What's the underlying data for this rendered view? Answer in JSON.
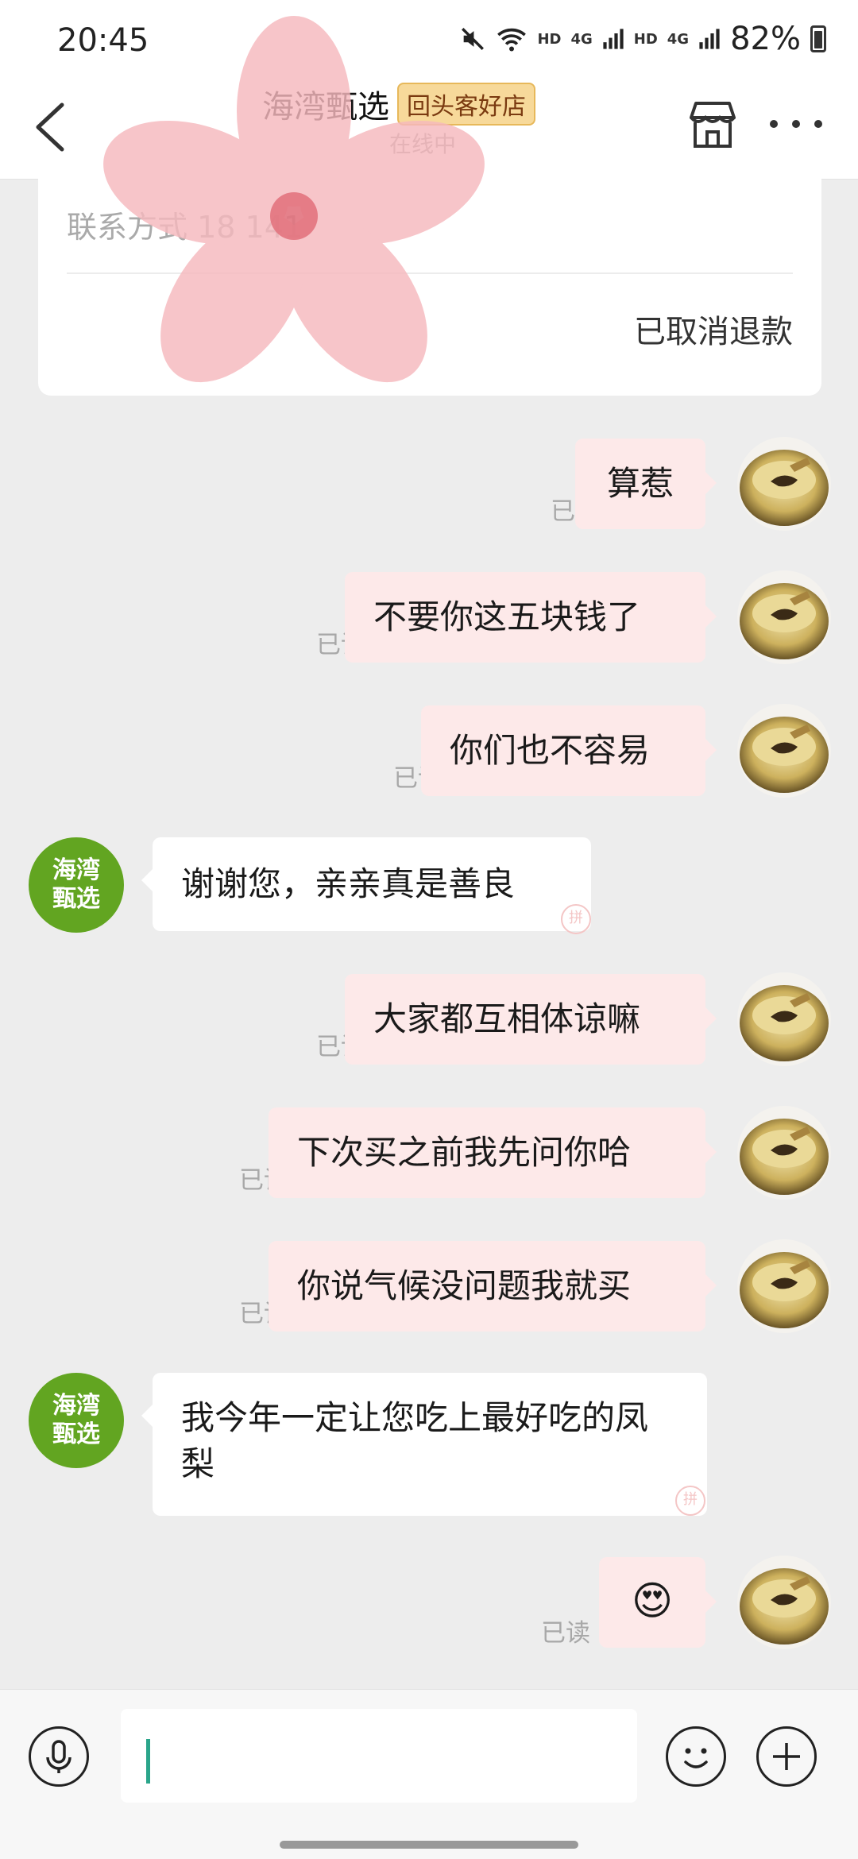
{
  "status_bar": {
    "time": "20:45",
    "hd1": "HD",
    "net1": "4G",
    "hd2": "HD",
    "net2": "4G",
    "battery": "82%"
  },
  "header": {
    "title": "海湾甄选",
    "badge": "回头客好店",
    "subtitle": "在线中"
  },
  "card": {
    "contact": "联系方式 18  141 ",
    "status": "已取消退款"
  },
  "read_label": "已读",
  "shop_avatar_text": "海湾\n甄选",
  "messages": [
    {
      "from": "me",
      "text": "算惹"
    },
    {
      "from": "me",
      "text": "不要你这五块钱了"
    },
    {
      "from": "me",
      "text": "你们也不容易"
    },
    {
      "from": "shop",
      "text": "谢谢您，亲亲真是善良"
    },
    {
      "from": "me",
      "text": "大家都互相体谅嘛"
    },
    {
      "from": "me",
      "text": "下次买之前我先问你哈"
    },
    {
      "from": "me",
      "text": "你说气候没问题我就买"
    },
    {
      "from": "shop",
      "text": "我今年一定让您吃上最好吃的凤梨"
    },
    {
      "from": "me",
      "text": "😍"
    }
  ],
  "colors": {
    "outgoing_bubble": "#fde9e9",
    "incoming_bubble": "#ffffff",
    "shop_avatar": "#62a521",
    "cursor": "#2aa58a",
    "background": "#ededed"
  },
  "icons": {
    "back": "chevron-left-icon",
    "shop": "store-icon",
    "more": "more-icon",
    "voice": "microphone-icon",
    "emoji": "smiley-icon",
    "add": "plus-icon"
  }
}
